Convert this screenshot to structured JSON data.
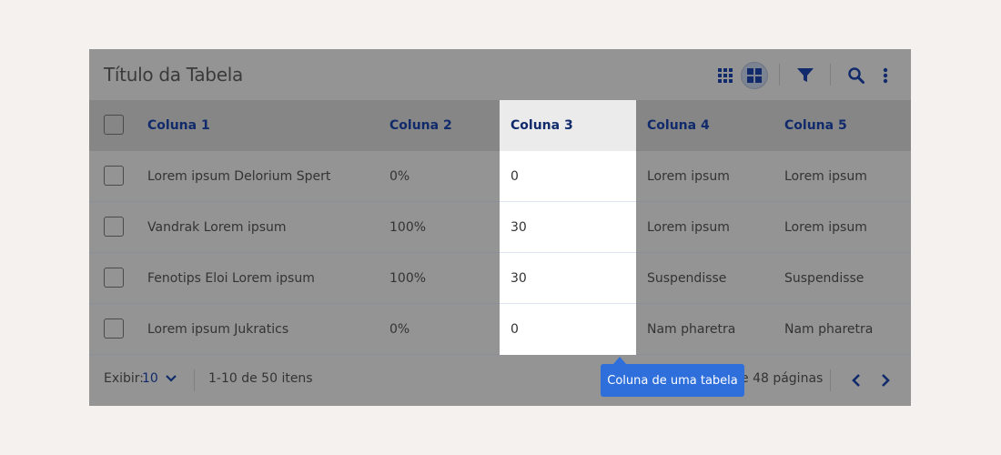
{
  "table": {
    "title": "Título da Tabela",
    "toolbar": {
      "icons": [
        "grid-small-icon",
        "grid-large-icon",
        "filter-icon",
        "search-icon",
        "more-vertical-icon"
      ]
    },
    "columns": [
      "Coluna 1",
      "Coluna 2",
      "Coluna 3",
      "Coluna 4",
      "Coluna 5"
    ],
    "rows": [
      [
        "Lorem ipsum Delorium Spert",
        "0%",
        "0",
        "Lorem ipsum",
        "Lorem ipsum"
      ],
      [
        "Vandrak Lorem ipsum",
        "100%",
        "30",
        "Lorem ipsum",
        "Lorem ipsum"
      ],
      [
        "Fenotips Eloi Lorem ipsum",
        "100%",
        "30",
        "Suspendisse",
        "Suspendisse"
      ],
      [
        "Lorem ipsum Jukratics",
        "0%",
        "0",
        "Nam pharetra",
        "Nam pharetra"
      ]
    ],
    "highlighted_column": "Coluna 3",
    "footer": {
      "show_label": "Exibir:",
      "show_value": "10",
      "range_text": "1-10 de 50 itens",
      "pages_text": "e 48 páginas"
    },
    "tooltip": "Coluna de uma tabela"
  },
  "colors": {
    "accent": "#102a6b",
    "tooltip": "#2f6fdb",
    "overlay": "#949494"
  }
}
